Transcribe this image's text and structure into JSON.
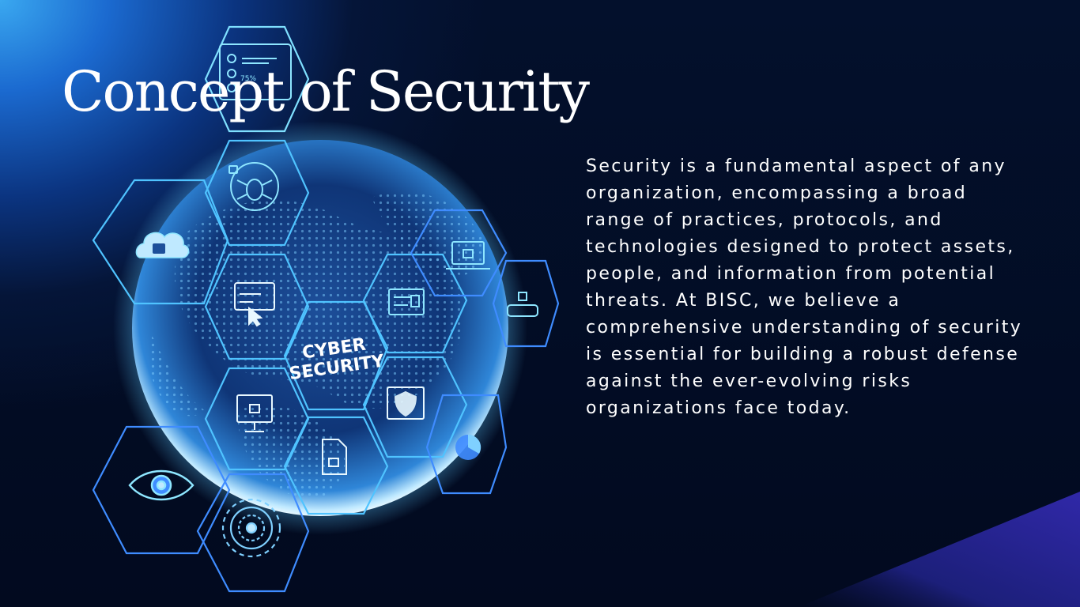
{
  "slide": {
    "title": "Concept of Security",
    "body": "Security is a fundamental aspect of any organization, encompassing a broad range of practices, protocols, and technologies designed to protect assets, people, and information from potential threats. At BISC, we believe a comprehensive understanding of security is essential for building a robust defense against the ever-evolving risks organizations face today."
  },
  "artwork": {
    "globe_label_line1": "CYBER",
    "globe_label_line2": "SECURITY",
    "progress_label": "75%",
    "icons": [
      "checklist-icon",
      "bug-icon",
      "cloud-lock-icon",
      "card-cursor-icon",
      "laptop-lock-icon",
      "password-field-icon",
      "dashboard-icon",
      "monitor-lock-icon",
      "shield-icon",
      "document-lock-icon",
      "pie-chart-icon",
      "eye-icon",
      "fingerprint-scanner-icon"
    ]
  },
  "colors": {
    "background": "#020a1f",
    "glow": "#3aa8f0",
    "hex_stroke": "#4fc3ff",
    "corner_accent": "#2d2aa0",
    "text": "#ffffff"
  }
}
